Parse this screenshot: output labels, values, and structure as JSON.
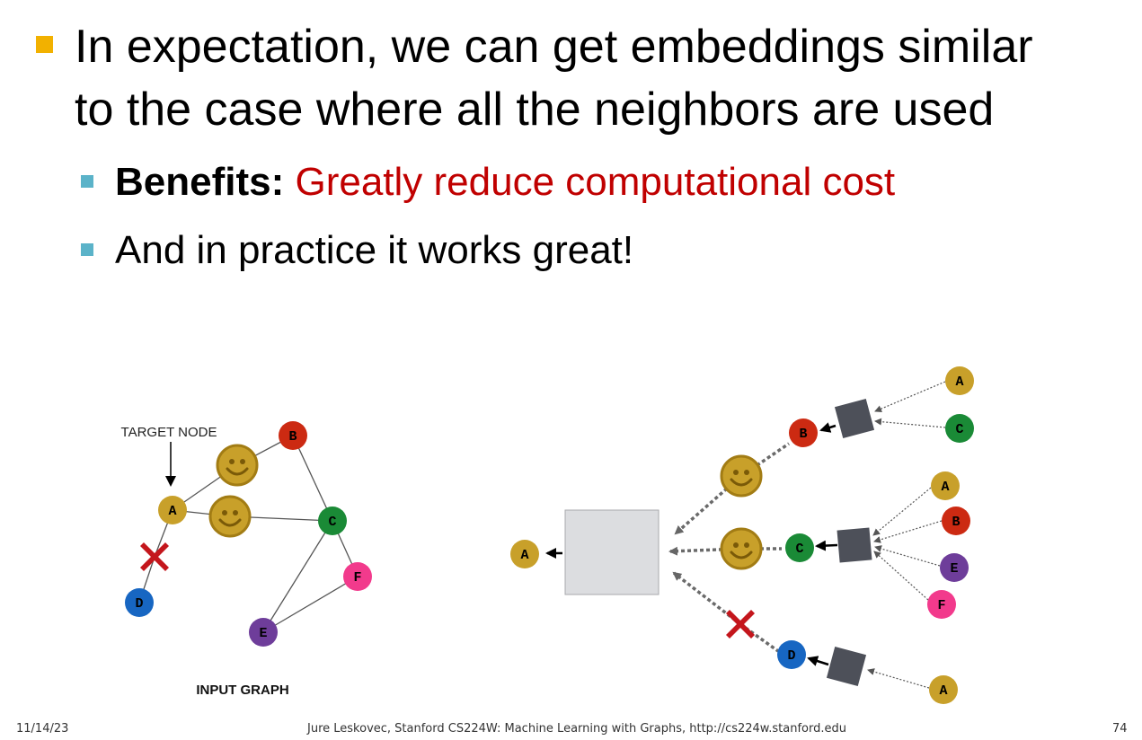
{
  "slide": {
    "bullet_main_line1": "In expectation, we can get embeddings similar",
    "bullet_main_line2": "to the case where all the neighbors are used",
    "sub1_bold": "Benefits:",
    "sub1_red": "Greatly reduce computational cost",
    "sub2": "And in practice it works great!"
  },
  "diagram": {
    "target_label": "TARGET NODE",
    "input_graph_label": "INPUT GRAPH",
    "nodes": {
      "A": "A",
      "B": "B",
      "C": "C",
      "D": "D",
      "E": "E",
      "F": "F"
    },
    "colors": {
      "A": "#c8a02a",
      "B": "#cc2a12",
      "C": "#1a8a36",
      "D": "#1766c2",
      "E": "#6e3d9a",
      "F": "#f23a8c",
      "smiley": "#c8a02a",
      "cross": "#c4161c",
      "aggregator": "#4d5059",
      "big_box": "#dcdde0"
    },
    "icons": [
      "smiley-icon",
      "cross-icon"
    ]
  },
  "footer": {
    "date": "11/14/23",
    "credit": "Jure Leskovec, Stanford CS224W: Machine Learning with Graphs, http://cs224w.stanford.edu",
    "page": "74"
  }
}
